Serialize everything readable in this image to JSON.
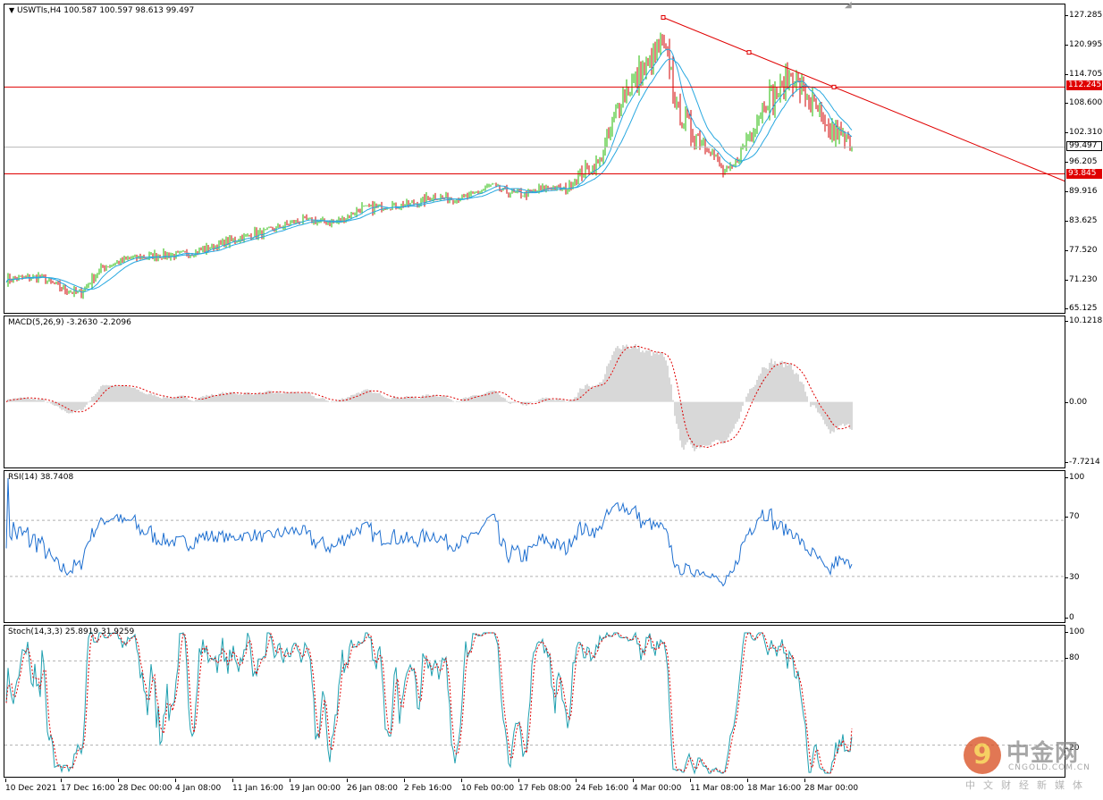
{
  "main": {
    "symbol_info": "USWTIs,H4  100.587 100.597 98.613 99.497",
    "scale": [
      "127.285",
      "120.995",
      "114.705",
      "108.600",
      "102.310",
      "96.205",
      "89.916",
      "83.625",
      "77.520",
      "71.230",
      "65.125"
    ],
    "hline_upper": "112.245",
    "hline_lower": "93.845",
    "current_price": "99.497"
  },
  "macd": {
    "label": "MACD(5,26,9) -3.2630 -2.2096",
    "scale": [
      "10.1218",
      "0.00",
      "-7.7214"
    ]
  },
  "rsi": {
    "label": "RSI(14) 38.7408",
    "scale": [
      "100",
      "70",
      "30",
      "0"
    ]
  },
  "stoch": {
    "label": "Stoch(14,3,3) 25.8919 31.9259",
    "scale": [
      "100",
      "80",
      "20"
    ]
  },
  "time_axis": [
    "10 Dec 2021",
    "17 Dec 16:00",
    "28 Dec 00:00",
    "4 Jan 08:00",
    "11 Jan 16:00",
    "19 Jan 00:00",
    "26 Jan 08:00",
    "2 Feb 16:00",
    "10 Feb 00:00",
    "17 Feb 08:00",
    "24 Feb 16:00",
    "4 Mar 00:00",
    "11 Mar 08:00",
    "18 Mar 16:00",
    "28 Mar 00:00"
  ],
  "logo": {
    "glyph": "9",
    "text_cn": "中金网",
    "text_en": "CNGOLD.COM.CN",
    "sub": "中文财经新媒体"
  },
  "colors": {
    "bull": "#22b800",
    "bear": "#d00000",
    "ma": "#28a8e0",
    "hline": "#e00000",
    "trend": "#e00000",
    "macd_hist": "#b0b0b0",
    "macd_signal": "#e00000",
    "rsi": "#1e6fd0",
    "stoch_main": "#20a0b0",
    "stoch_signal": "#e00000"
  },
  "chart_data": {
    "type": "candlestick",
    "categories": [
      "10 Dec 2021",
      "17 Dec 16:00",
      "28 Dec 00:00",
      "4 Jan 08:00",
      "11 Jan 16:00",
      "19 Jan 00:00",
      "26 Jan 08:00",
      "2 Feb 16:00",
      "10 Feb 00:00",
      "17 Feb 08:00",
      "24 Feb 16:00",
      "4 Mar 00:00",
      "11 Mar 08:00",
      "18 Mar 16:00",
      "28 Mar 00:00"
    ],
    "ylim": [
      65.125,
      127.285
    ],
    "close_anchors": [
      [
        0,
        71.5
      ],
      [
        40,
        72.0
      ],
      [
        70,
        69.0
      ],
      [
        85,
        68.5
      ],
      [
        110,
        74.0
      ],
      [
        140,
        76.0
      ],
      [
        180,
        76.5
      ],
      [
        210,
        77.0
      ],
      [
        250,
        79.5
      ],
      [
        290,
        81.5
      ],
      [
        330,
        84.0
      ],
      [
        370,
        83.5
      ],
      [
        400,
        86.5
      ],
      [
        430,
        87.0
      ],
      [
        460,
        87.5
      ],
      [
        480,
        89.0
      ],
      [
        500,
        88.5
      ],
      [
        520,
        89.0
      ],
      [
        545,
        91.5
      ],
      [
        560,
        90.0
      ],
      [
        585,
        89.5
      ],
      [
        605,
        91.0
      ],
      [
        630,
        90.5
      ],
      [
        645,
        94.0
      ],
      [
        665,
        96.0
      ],
      [
        690,
        110.0
      ],
      [
        720,
        117.0
      ],
      [
        735,
        121.0
      ],
      [
        745,
        117.0
      ],
      [
        752,
        107.0
      ],
      [
        770,
        103.0
      ],
      [
        790,
        99.0
      ],
      [
        805,
        94.0
      ],
      [
        815,
        95.0
      ],
      [
        830,
        101.0
      ],
      [
        850,
        109.0
      ],
      [
        870,
        112.0
      ],
      [
        880,
        115.0
      ],
      [
        895,
        111.0
      ],
      [
        910,
        107.0
      ],
      [
        920,
        102.0
      ],
      [
        930,
        103.0
      ],
      [
        940,
        101.0
      ],
      [
        948,
        99.5
      ]
    ],
    "ma_period": 10,
    "ma_periods_extra": [
      20
    ],
    "macd": {
      "fast": 5,
      "slow": 26,
      "signal": 9,
      "last_main": -3.263,
      "last_signal": -2.2096,
      "ylim": [
        -7.7214,
        10.1218
      ]
    },
    "rsi": {
      "period": 14,
      "last": 38.7408,
      "ylim": [
        0,
        100
      ],
      "levels": [
        30,
        70
      ]
    },
    "stoch": {
      "k": 14,
      "d": 3,
      "slowing": 3,
      "last_main": 25.8919,
      "last_signal": 31.9259,
      "ylim": [
        0,
        100
      ],
      "levels": [
        20,
        80
      ]
    },
    "hlines": [
      112.245,
      93.845
    ],
    "trendline_points": [
      [
        "4 Mar 00:00",
        127.0
      ],
      [
        "28 Mar 00:00",
        112.245
      ]
    ]
  }
}
